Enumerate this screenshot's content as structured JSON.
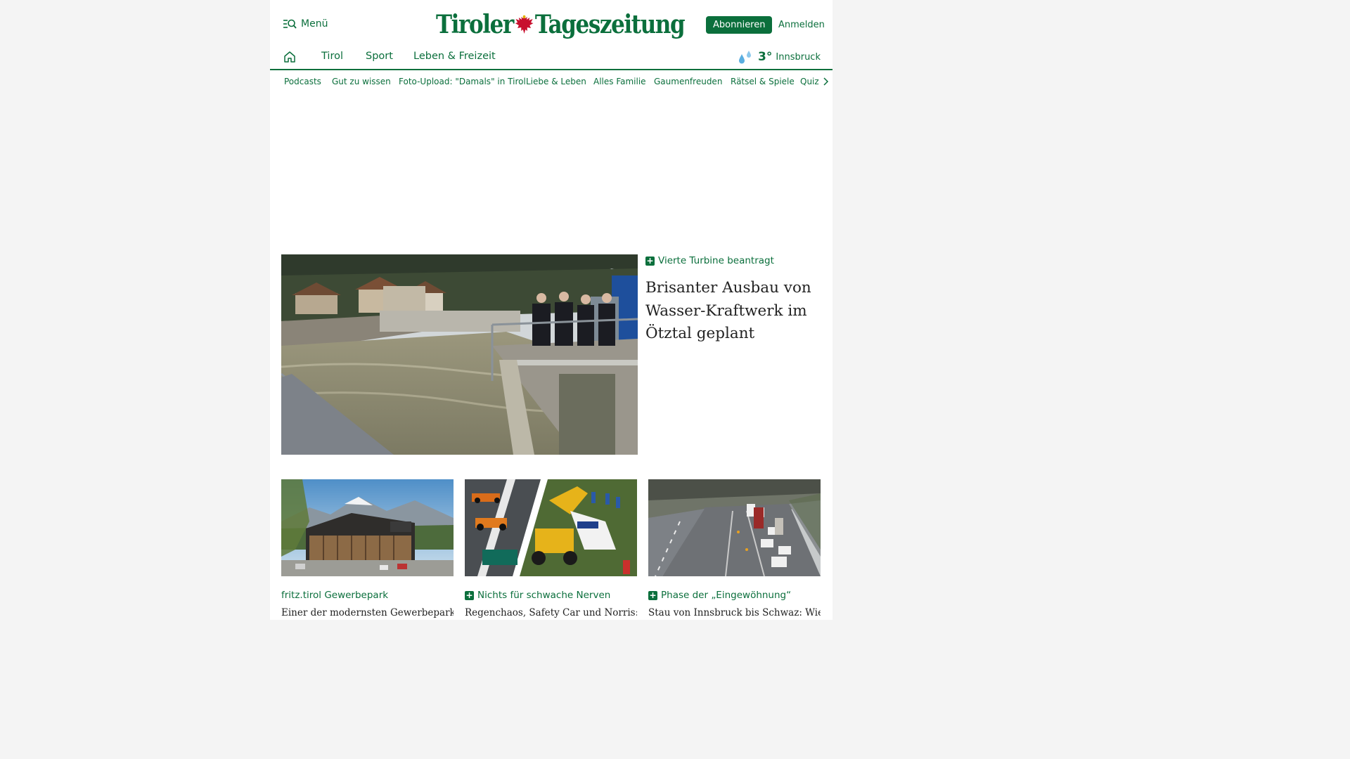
{
  "header": {
    "menu_label": "Menü",
    "logo_left": "Tiroler",
    "logo_right": "Tageszeitung",
    "subscribe_label": "Abonnieren",
    "login_label": "Anmelden",
    "brand_color": "#0b6f3c",
    "eagle_color": "#c8102e"
  },
  "main_nav": {
    "items": [
      "Tirol",
      "Sport",
      "Leben & Freizeit"
    ]
  },
  "weather": {
    "temperature": "3°",
    "city": "Innsbruck",
    "icon": "rain-drops-icon"
  },
  "sub_nav": {
    "items": [
      "Podcasts",
      "Gut zu wissen",
      "Foto-Upload: \"Damals\" in Tirol",
      "Liebe & Leben",
      "Alles Familie",
      "Gaumenfreuden",
      "Rätsel & Spiele",
      "Quiz"
    ]
  },
  "hero": {
    "kicker": "Vierte Turbine beantragt",
    "title": "Brisanter Ausbau von Wasser-Kraftwerk im Ötztal geplant",
    "premium": true
  },
  "cards": [
    {
      "kicker": "fritz.tirol Gewerbepark",
      "title": "Einer der modernsten Gewerbeparks",
      "premium": false
    },
    {
      "kicker": "Nichts für schwache Nerven",
      "title": "Regenchaos, Safety Car und Norris:",
      "premium": true
    },
    {
      "kicker": "Phase der „Eingewöhnung“",
      "title": "Stau von Innsbruck bis Schwaz: Wie",
      "premium": true
    }
  ]
}
